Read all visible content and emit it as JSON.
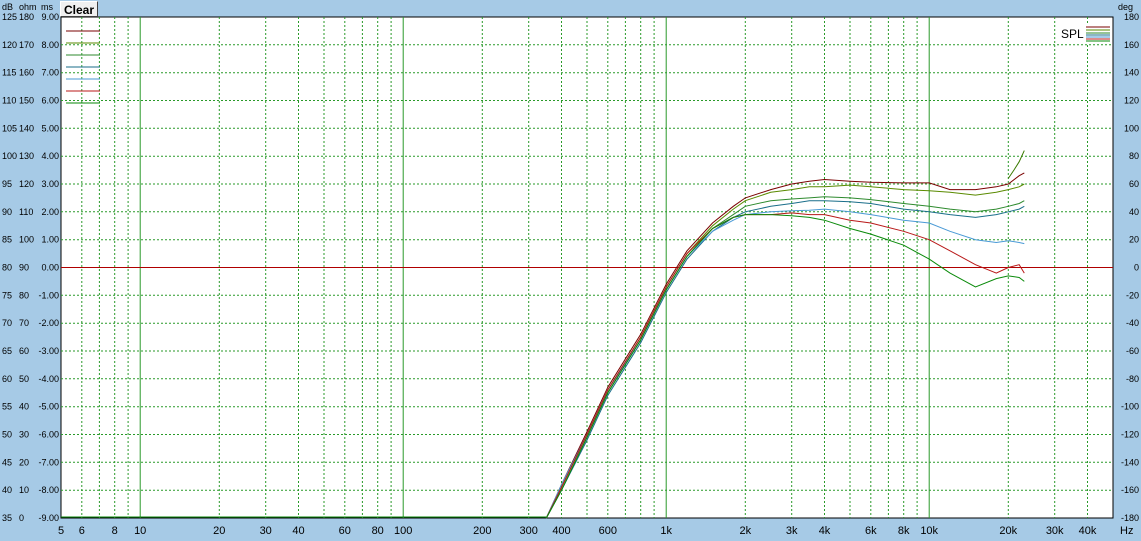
{
  "toolbar": {
    "clear_label": "Clear"
  },
  "legend": {
    "label": "SPL"
  },
  "colors": {
    "background": "#a6cae6",
    "plot": "#ffffff",
    "grid": "#2a9a2a",
    "zero_line": "#b00000"
  },
  "chart_data": {
    "type": "line",
    "title": "",
    "xscale": "log",
    "xlim": [
      5,
      50000
    ],
    "ylim": [
      35,
      125
    ],
    "axis_headers": {
      "left": [
        "dB",
        "ohm",
        "ms"
      ],
      "right": "deg",
      "x_unit": "Hz"
    },
    "x_ticks": [
      {
        "v": 5,
        "t": "5"
      },
      {
        "v": 6,
        "t": "6"
      },
      {
        "v": 8,
        "t": "8"
      },
      {
        "v": 10,
        "t": "10"
      },
      {
        "v": 20,
        "t": "20"
      },
      {
        "v": 30,
        "t": "30"
      },
      {
        "v": 40,
        "t": "40"
      },
      {
        "v": 60,
        "t": "60"
      },
      {
        "v": 80,
        "t": "80"
      },
      {
        "v": 100,
        "t": "100"
      },
      {
        "v": 200,
        "t": "200"
      },
      {
        "v": 300,
        "t": "300"
      },
      {
        "v": 400,
        "t": "400"
      },
      {
        "v": 600,
        "t": "600"
      },
      {
        "v": 1000,
        "t": "1k"
      },
      {
        "v": 2000,
        "t": "2k"
      },
      {
        "v": 3000,
        "t": "3k"
      },
      {
        "v": 4000,
        "t": "4k"
      },
      {
        "v": 6000,
        "t": "6k"
      },
      {
        "v": 8000,
        "t": "8k"
      },
      {
        "v": 10000,
        "t": "10k"
      },
      {
        "v": 20000,
        "t": "20k"
      },
      {
        "v": 30000,
        "t": "30k"
      },
      {
        "v": 40000,
        "t": "40k"
      }
    ],
    "y_ticks": {
      "db": [
        "125",
        "120",
        "115",
        "110",
        "105",
        "100",
        "95",
        "90",
        "85",
        "80",
        "75",
        "70",
        "65",
        "60",
        "55",
        "50",
        "45",
        "40",
        "35"
      ],
      "ohm": [
        "180",
        "170",
        "160",
        "150",
        "140",
        "130",
        "120",
        "110",
        "100",
        "90",
        "80",
        "70",
        "60",
        "50",
        "40",
        "30",
        "20",
        "10",
        "0"
      ],
      "ms": [
        "9.00",
        "8.00",
        "7.00",
        "6.00",
        "5.00",
        "4.00",
        "3.00",
        "2.00",
        "1.00",
        "0.00",
        "-1.00",
        "-2.00",
        "-3.00",
        "-4.00",
        "-5.00",
        "-6.00",
        "-7.00",
        "-8.00",
        "-9.00"
      ],
      "deg": [
        "180",
        "160",
        "140",
        "120",
        "100",
        "80",
        "60",
        "40",
        "20",
        "0",
        "-20",
        "-40",
        "-60",
        "-80",
        "-100",
        "-120",
        "-140",
        "-160",
        "-180"
      ]
    },
    "reference_line": {
      "y": 80
    },
    "series": [
      {
        "color": "#7a0000",
        "x": [
          350,
          400,
          500,
          600,
          800,
          1000,
          1200,
          1500,
          1800,
          2000,
          2500,
          3000,
          3500,
          4000,
          5000,
          6000,
          8000,
          10000,
          12000,
          15000,
          18000,
          20000,
          22000,
          23000
        ],
        "y": [
          35,
          41,
          50.5,
          58.5,
          68,
          77,
          83,
          88,
          91,
          92.5,
          94,
          95,
          95.5,
          95.8,
          95.5,
          95.3,
          95.2,
          95.2,
          94,
          94,
          94.5,
          95,
          96.5,
          97
        ]
      },
      {
        "color": "#5a8a00",
        "x": [
          350,
          400,
          500,
          600,
          800,
          1000,
          1200,
          1500,
          1800,
          2000,
          2500,
          3000,
          3500,
          4000,
          5000,
          6000,
          8000,
          10000,
          12000,
          15000,
          18000,
          20000,
          22000,
          23000
        ],
        "y": [
          35,
          40.5,
          50,
          58,
          67.5,
          76.5,
          82.5,
          87.5,
          90.5,
          92,
          93.5,
          94,
          94.5,
          94.5,
          94.8,
          94.5,
          94,
          93.8,
          93.5,
          93,
          93.5,
          94,
          94.5,
          95
        ]
      },
      {
        "color": "#2e8a2e",
        "x": [
          350,
          400,
          500,
          600,
          800,
          1000,
          1200,
          1500,
          1800,
          2000,
          2500,
          3000,
          3500,
          4000,
          5000,
          6000,
          8000,
          10000,
          12000,
          15000,
          18000,
          20000,
          22000,
          23000
        ],
        "y": [
          35,
          40,
          49.5,
          57.5,
          67,
          76,
          82,
          87,
          89.5,
          91,
          92,
          92.3,
          92.5,
          92.7,
          92.5,
          92.2,
          91.5,
          91,
          90.5,
          90,
          90.5,
          91,
          91.5,
          92
        ]
      },
      {
        "color": "#1a6e8a",
        "x": [
          350,
          400,
          500,
          600,
          800,
          1000,
          1200,
          1500,
          1800,
          2000,
          2500,
          3000,
          3500,
          4000,
          5000,
          6000,
          8000,
          10000,
          12000,
          15000,
          18000,
          20000,
          22000,
          23000
        ],
        "y": [
          35,
          40,
          49,
          57,
          66.5,
          75.5,
          81.5,
          86.5,
          89,
          90,
          91,
          91.5,
          92,
          92,
          91.8,
          91.5,
          90.5,
          90,
          89.5,
          89,
          89.5,
          90,
          90.5,
          91
        ]
      },
      {
        "color": "#4a9ad6",
        "x": [
          350,
          400,
          500,
          600,
          800,
          1000,
          1200,
          1500,
          1800,
          2000,
          2500,
          3000,
          3500,
          4000,
          5000,
          6000,
          8000,
          10000,
          12000,
          15000,
          18000,
          20000,
          22000,
          23000
        ],
        "y": [
          35,
          41,
          50,
          58,
          67,
          76,
          82,
          86.5,
          88.5,
          89.5,
          90,
          90.2,
          90.3,
          90.5,
          90,
          89.5,
          88.5,
          88,
          86.5,
          85,
          84.5,
          84.8,
          84.5,
          84.3
        ]
      },
      {
        "color": "#b81818",
        "x": [
          350,
          400,
          500,
          600,
          800,
          1000,
          1200,
          1500,
          1800,
          2000,
          2500,
          3000,
          3500,
          4000,
          5000,
          6000,
          8000,
          10000,
          12000,
          15000,
          18000,
          20000,
          22000,
          23000
        ],
        "y": [
          35,
          40.5,
          50,
          58,
          67.5,
          76.5,
          82.5,
          87,
          89,
          89.5,
          89.5,
          89.8,
          89.5,
          89.5,
          88.5,
          88,
          86.5,
          85,
          83,
          80.5,
          79,
          80,
          80.5,
          79
        ]
      },
      {
        "color": "#0a8a0a",
        "x": [
          350,
          400,
          500,
          600,
          800,
          1000,
          1200,
          1500,
          1800,
          2000,
          2500,
          3000,
          3500,
          4000,
          5000,
          6000,
          8000,
          10000,
          12000,
          15000,
          18000,
          20000,
          22000,
          23000
        ],
        "y": [
          35,
          40,
          49.5,
          57.5,
          67,
          76,
          82,
          87,
          89,
          89.5,
          89.5,
          89.3,
          89,
          88.5,
          87,
          86,
          84,
          81.5,
          79,
          76.5,
          78,
          78.5,
          78.2,
          77.5
        ]
      },
      {
        "color": "#3a7a00",
        "x": [
          20000,
          21000,
          22000,
          23000
        ],
        "y": [
          96,
          97.5,
          99,
          101
        ]
      }
    ]
  }
}
